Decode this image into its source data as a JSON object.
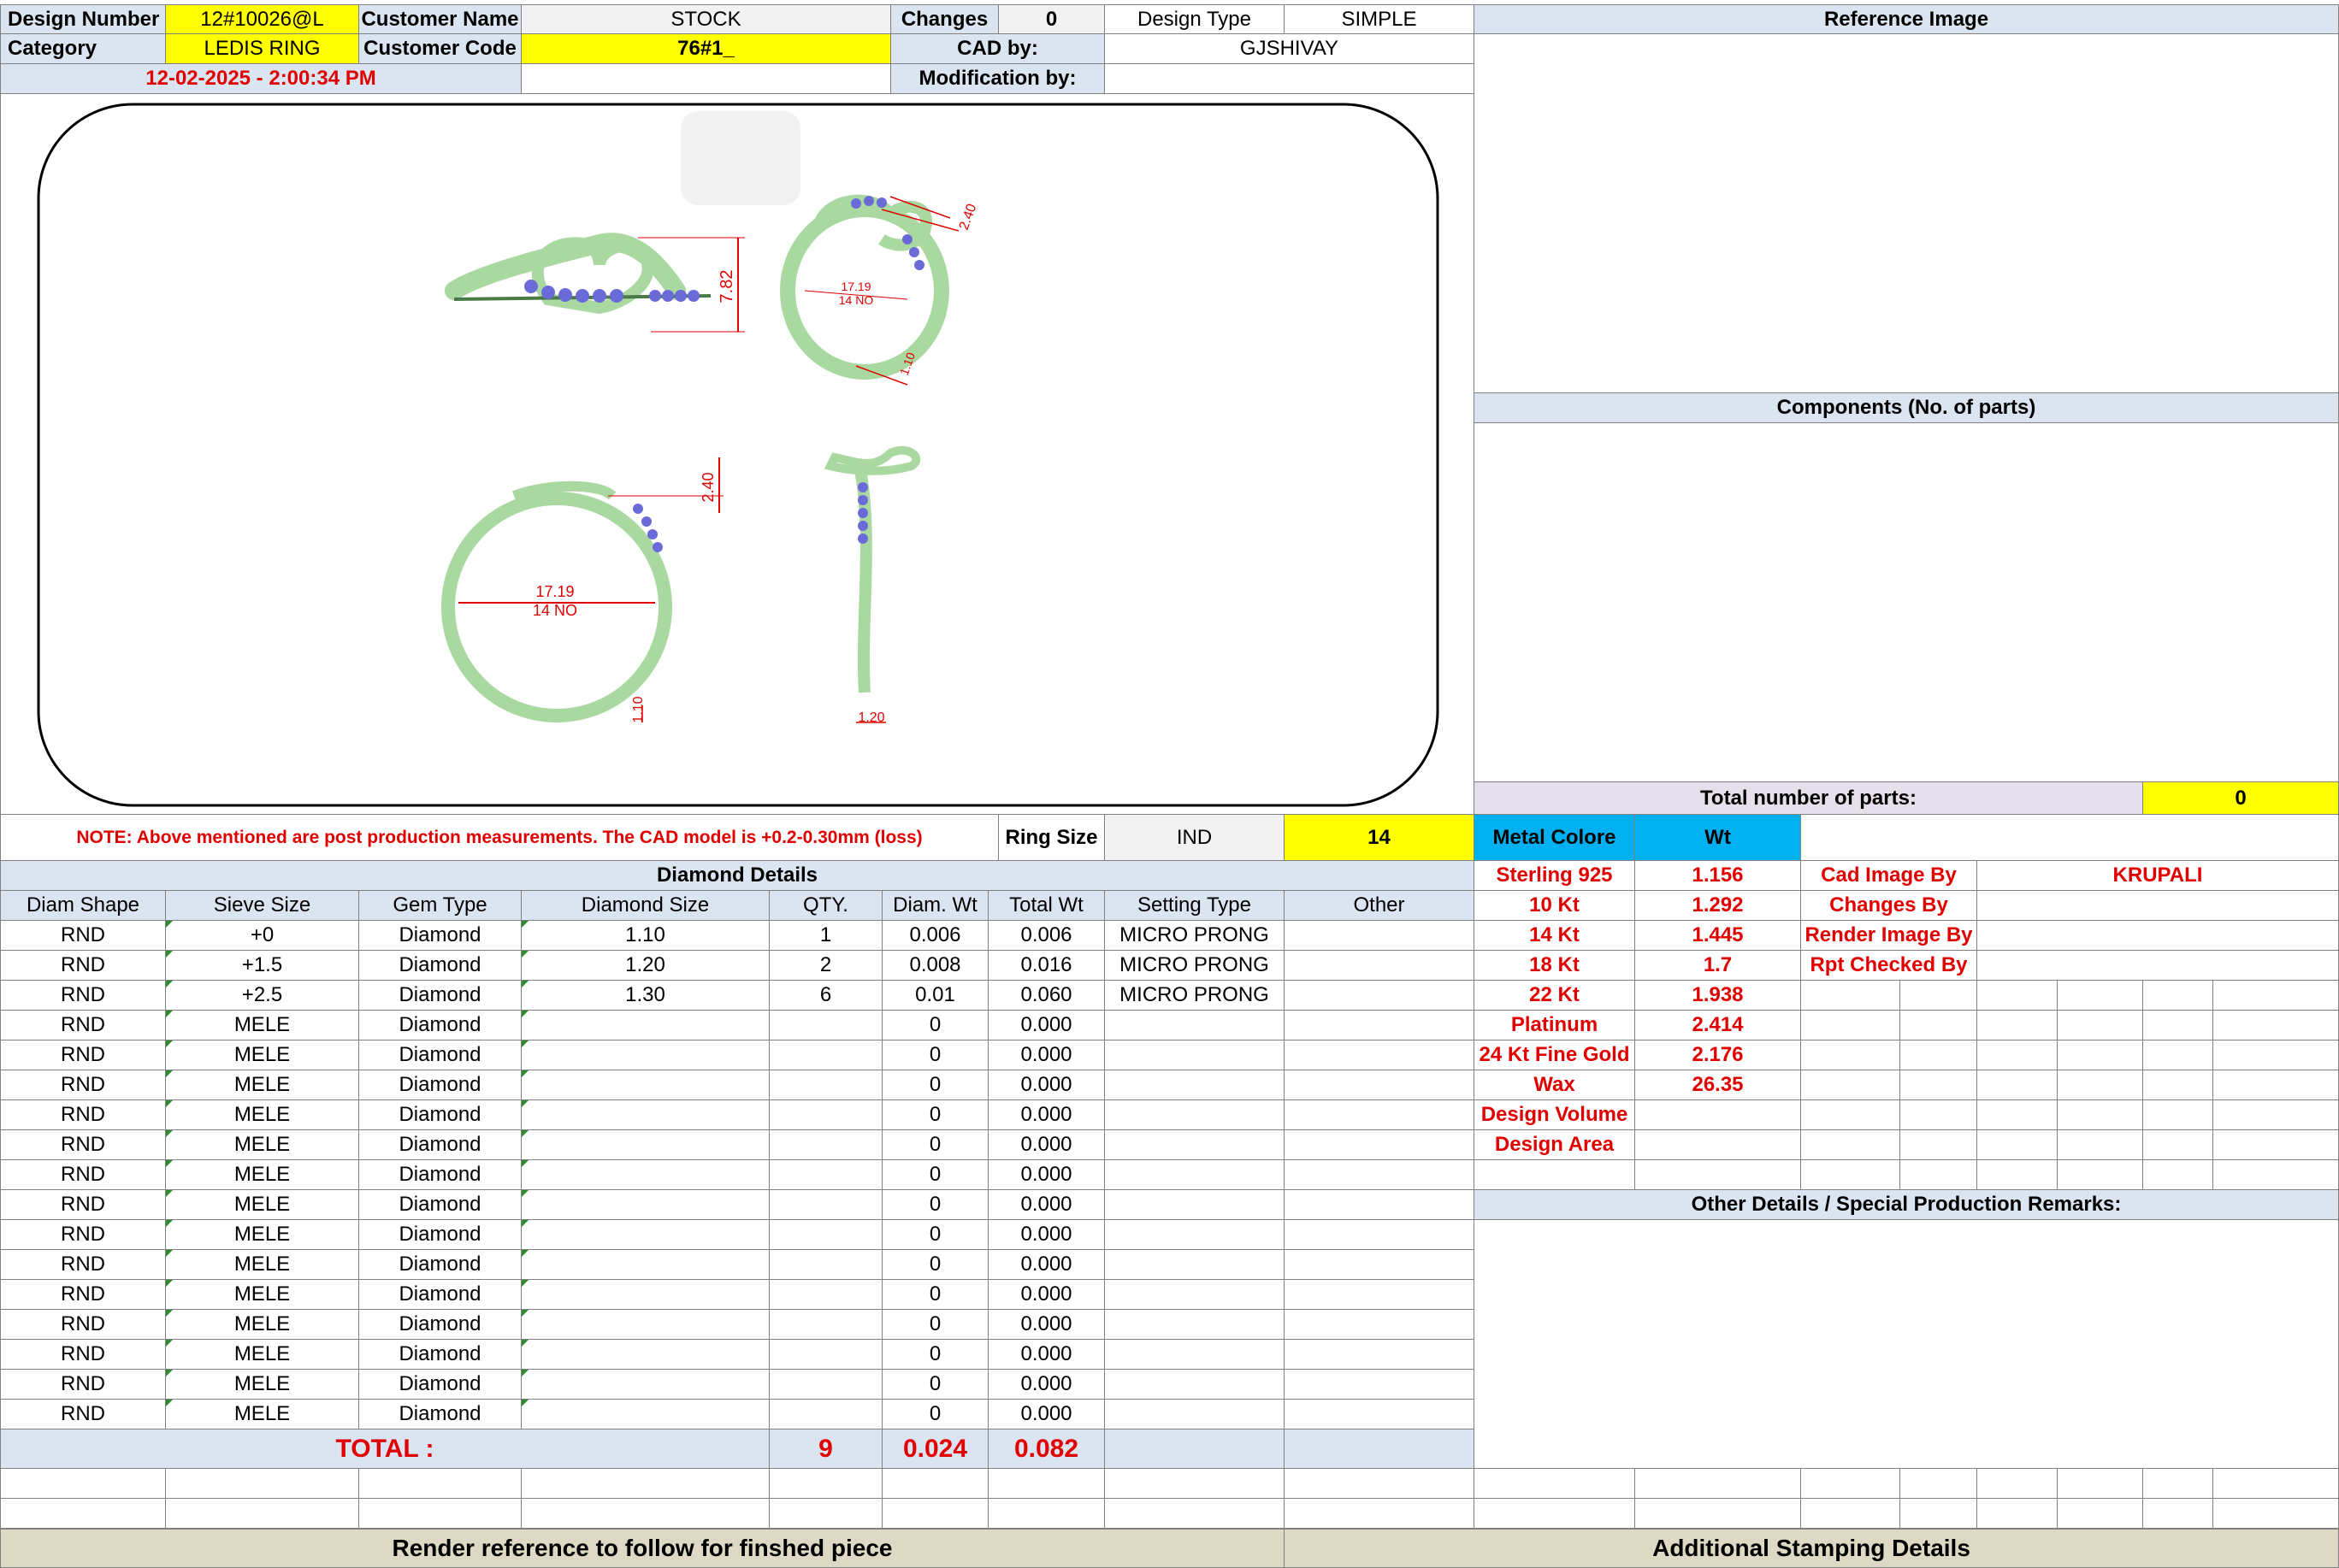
{
  "header": {
    "design_number_label": "Design Number",
    "design_number": "12#10026@L",
    "customer_name_label": "Customer Name",
    "customer_name": "STOCK",
    "changes_label": "Changes",
    "changes": "0",
    "design_type_label": "Design Type",
    "design_type": "SIMPLE",
    "category_label": "Category",
    "category": "LEDIS RING",
    "customer_code_label": "Customer Code",
    "customer_code": "76#1_",
    "cad_by_label": "CAD by:",
    "cad_by": "GJSHIVAY",
    "timestamp": "12-02-2025 - 2:00:34 PM",
    "modification_by_label": "Modification by:",
    "modification_by": ""
  },
  "right_panel": {
    "reference_image_title": "Reference Image",
    "components_title": "Components (No. of parts)",
    "total_parts_label": "Total number of parts:",
    "total_parts": "0",
    "other_details_title": "Other Details / Special Production Remarks:"
  },
  "cad_view": {
    "side_height": "7.82",
    "top_width": "17.19",
    "top_size": "14 NO",
    "top_dim_a": "2.40",
    "top_dim_b": "1.10",
    "front_inner": "17.19",
    "front_size": "14 NO",
    "front_top": "2.40",
    "front_bottom": "1.10",
    "profile_width": "1.20",
    "accent_colors": {
      "metal": "#a9d9a0",
      "stones": "#6a6ad8",
      "dimension": "#e00000"
    }
  },
  "note": "NOTE: Above mentioned are post production measurements. The CAD model is +0.2-0.30mm (loss)",
  "ring_size": {
    "label": "Ring Size",
    "system": "IND",
    "value": "14"
  },
  "metal": {
    "header_label": "Metal Colore",
    "header_wt": "Wt",
    "rows": [
      {
        "name": "Sterling 925",
        "wt": "1.156"
      },
      {
        "name": "10 Kt",
        "wt": "1.292"
      },
      {
        "name": "14 Kt",
        "wt": "1.445"
      },
      {
        "name": "18 Kt",
        "wt": "1.7"
      },
      {
        "name": "22 Kt",
        "wt": "1.938"
      },
      {
        "name": "Platinum",
        "wt": "2.414"
      },
      {
        "name": "24 Kt Fine Gold",
        "wt": "2.176"
      },
      {
        "name": "Wax",
        "wt": "26.35"
      },
      {
        "name": "Design Volume",
        "wt": ""
      },
      {
        "name": "Design Area",
        "wt": ""
      }
    ]
  },
  "credits": [
    {
      "label": "Cad Image By",
      "value": "KRUPALI"
    },
    {
      "label": "Changes By",
      "value": ""
    },
    {
      "label": "Render Image By",
      "value": ""
    },
    {
      "label": "Rpt Checked By",
      "value": ""
    }
  ],
  "diamond": {
    "title": "Diamond Details",
    "columns": [
      "Diam Shape",
      "Sieve Size",
      "Gem Type",
      "Diamond Size",
      "QTY.",
      "Diam. Wt",
      "Total Wt",
      "Setting Type",
      "Other"
    ],
    "rows": [
      [
        "RND",
        "+0",
        "Diamond",
        "1.10",
        "1",
        "0.006",
        "0.006",
        "MICRO PRONG",
        ""
      ],
      [
        "RND",
        "+1.5",
        "Diamond",
        "1.20",
        "2",
        "0.008",
        "0.016",
        "MICRO PRONG",
        ""
      ],
      [
        "RND",
        "+2.5",
        "Diamond",
        "1.30",
        "6",
        "0.01",
        "0.060",
        "MICRO PRONG",
        ""
      ],
      [
        "RND",
        "MELE",
        "Diamond",
        "",
        "",
        "0",
        "0.000",
        "",
        ""
      ],
      [
        "RND",
        "MELE",
        "Diamond",
        "",
        "",
        "0",
        "0.000",
        "",
        ""
      ],
      [
        "RND",
        "MELE",
        "Diamond",
        "",
        "",
        "0",
        "0.000",
        "",
        ""
      ],
      [
        "RND",
        "MELE",
        "Diamond",
        "",
        "",
        "0",
        "0.000",
        "",
        ""
      ],
      [
        "RND",
        "MELE",
        "Diamond",
        "",
        "",
        "0",
        "0.000",
        "",
        ""
      ],
      [
        "RND",
        "MELE",
        "Diamond",
        "",
        "",
        "0",
        "0.000",
        "",
        ""
      ],
      [
        "RND",
        "MELE",
        "Diamond",
        "",
        "",
        "0",
        "0.000",
        "",
        ""
      ],
      [
        "RND",
        "MELE",
        "Diamond",
        "",
        "",
        "0",
        "0.000",
        "",
        ""
      ],
      [
        "RND",
        "MELE",
        "Diamond",
        "",
        "",
        "0",
        "0.000",
        "",
        ""
      ],
      [
        "RND",
        "MELE",
        "Diamond",
        "",
        "",
        "0",
        "0.000",
        "",
        ""
      ],
      [
        "RND",
        "MELE",
        "Diamond",
        "",
        "",
        "0",
        "0.000",
        "",
        ""
      ],
      [
        "RND",
        "MELE",
        "Diamond",
        "",
        "",
        "0",
        "0.000",
        "",
        ""
      ],
      [
        "RND",
        "MELE",
        "Diamond",
        "",
        "",
        "0",
        "0.000",
        "",
        ""
      ],
      [
        "RND",
        "MELE",
        "Diamond",
        "",
        "",
        "0",
        "0.000",
        "",
        ""
      ]
    ],
    "total_label": "TOTAL :",
    "total_qty": "9",
    "total_diam_wt": "0.024",
    "total_wt": "0.082"
  },
  "footer": {
    "render_reference": "Render reference to follow for finshed piece",
    "stamping": "Additional Stamping Details"
  }
}
